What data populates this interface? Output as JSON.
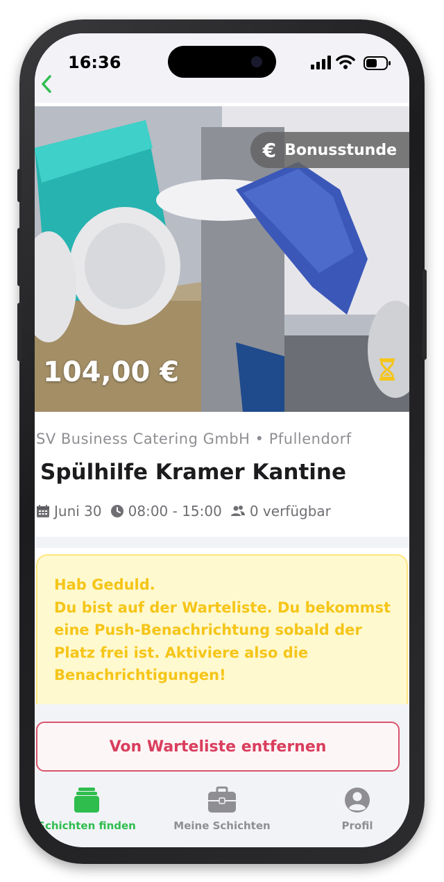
{
  "status_bar": {
    "time": "16:36"
  },
  "nav": {
    "back_icon": "chevron-left-icon",
    "accent_color": "#2fbd4e"
  },
  "hero": {
    "badge_label": "Bonusstunde",
    "badge_icon": "euro-icon",
    "price": "104,00 €",
    "status_icon": "hourglass-icon",
    "status_color": "#f5c518"
  },
  "shift": {
    "company": "SV Business Catering GmbH • Pfullendorf",
    "title": "Spülhilfe Kramer Kantine",
    "date": "Juni 30",
    "time_range": "08:00 - 15:00",
    "availability": "0 verfügbar"
  },
  "notice": {
    "text": "Hab Geduld.\nDu bist auf der Warteliste. Du bekommst eine Push-Benachrichtung sobald der Platz frei ist. Aktiviere also die Benachrichtigungen!",
    "color": "#f5c518"
  },
  "actions": {
    "remove_label": "Von Warteliste entfernen",
    "remove_color": "#d93e5d"
  },
  "tabbar": {
    "tabs": [
      {
        "label": "Schichten finden",
        "icon": "stack-icon",
        "active": true
      },
      {
        "label": "Meine Schichten",
        "icon": "briefcase-icon",
        "active": false
      },
      {
        "label": "Profil",
        "icon": "profile-icon",
        "active": false
      }
    ]
  }
}
